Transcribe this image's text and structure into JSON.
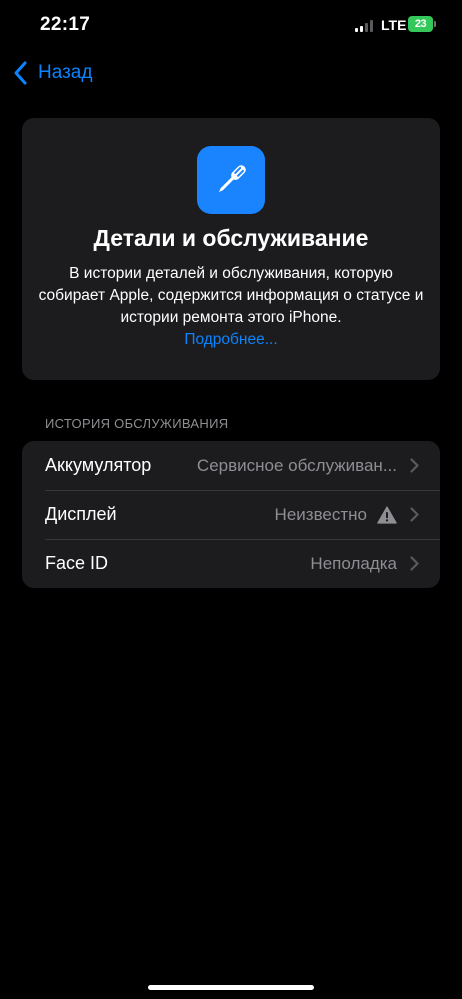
{
  "status_bar": {
    "time": "22:17",
    "network": "LTE",
    "battery_level": "23"
  },
  "nav": {
    "back_label": "Назад"
  },
  "header_card": {
    "icon": "screwdriver-icon",
    "title": "Детали и обслуживание",
    "description": "В истории деталей и обслуживания, которую собирает Apple, содержится информация о статусе и истории ремонта этого iPhone.",
    "link_label": "Подробнее..."
  },
  "service_history": {
    "header": "ИСТОРИЯ ОБСЛУЖИВАНИЯ",
    "rows": [
      {
        "title": "Аккумулятор",
        "value": "Сервисное обслуживан..."
      },
      {
        "title": "Дисплей",
        "value": "Неизвестно",
        "icon": "warning-icon"
      },
      {
        "title": "Face ID",
        "value": "Неполадка"
      }
    ]
  },
  "colors": {
    "accent": "#0a84ff",
    "card_background": "#1c1c1e",
    "secondary_text": "#8e8e93",
    "battery": "#34c759"
  }
}
